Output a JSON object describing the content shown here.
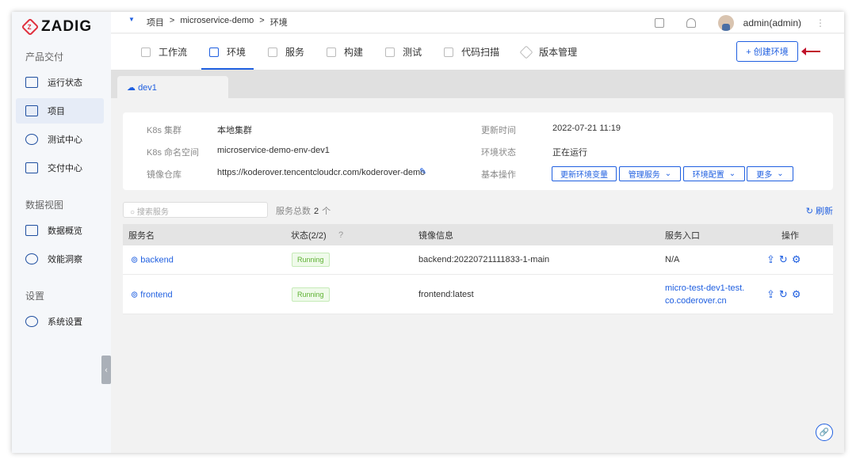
{
  "brand": "ZADIG",
  "sidebar": {
    "sections": [
      {
        "title": "产品交付",
        "items": [
          "运行状态",
          "项目",
          "测试中心",
          "交付中心"
        ]
      },
      {
        "title": "数据视图",
        "items": [
          "数据概览",
          "效能洞察"
        ]
      },
      {
        "title": "设置",
        "items": [
          "系统设置"
        ]
      }
    ],
    "active": "项目"
  },
  "breadcrumb": [
    "项目",
    ">",
    "microservice-demo",
    ">",
    "环境"
  ],
  "user": "admin(admin)",
  "tabs": [
    "工作流",
    "环境",
    "服务",
    "构建",
    "测试",
    "代码扫描",
    "版本管理"
  ],
  "active_tab": "环境",
  "create_button": "+ 创建环境",
  "env_tab": "dev1",
  "info": {
    "cluster_label": "K8s 集群",
    "cluster": "本地集群",
    "ns_label": "K8s 命名空间",
    "ns": "microservice-demo-env-dev1",
    "registry_label": "镜像仓库",
    "registry": "https://koderover.tencentcloudcr.com/koderover-demo",
    "updated_label": "更新时间",
    "updated": "2022-07-21 11:19",
    "status_label": "环境状态",
    "status": "正在运行",
    "ops_label": "基本操作",
    "ops": [
      "更新环境变量",
      "管理服务",
      "环境配置",
      "更多"
    ]
  },
  "search_placeholder": "搜索服务",
  "count_label": "服务总数",
  "count": "2",
  "count_unit": "个",
  "refresh": "刷新",
  "table": {
    "headers": [
      "服务名",
      "状态(2/2)",
      "镜像信息",
      "服务入口",
      "操作"
    ],
    "rows": [
      {
        "name": "backend",
        "status": "Running",
        "image": "backend:20220721111833-1-main",
        "entry": "N/A"
      },
      {
        "name": "frontend",
        "status": "Running",
        "image": "frontend:latest",
        "entry": "micro-test-dev1-test.",
        "entry2": "co.coderover.cn"
      }
    ]
  },
  "accent": "#1f5fe0"
}
